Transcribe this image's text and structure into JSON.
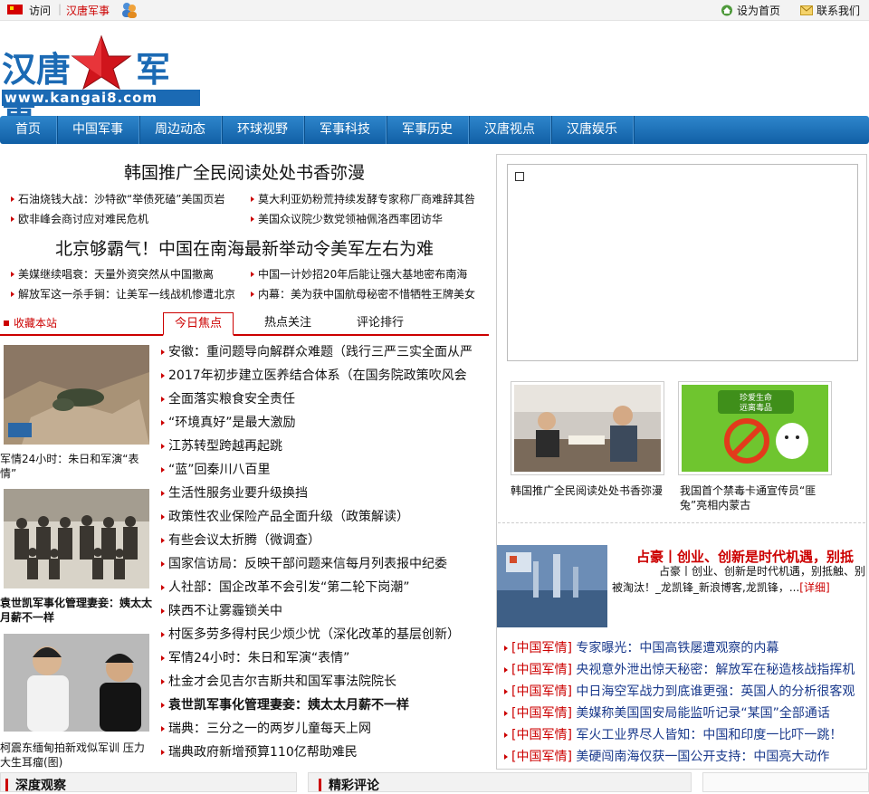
{
  "topbar": {
    "visit": "访问",
    "separator": "|",
    "site": "汉唐军事",
    "set_home": "设为首页",
    "contact": "联系我们"
  },
  "logo": {
    "name_left": "汉唐",
    "name_right": "军事",
    "url": "www.kangai8.com"
  },
  "nav": [
    "首页",
    "中国军事",
    "周边动态",
    "环球视野",
    "军事科技",
    "军事历史",
    "汉唐视点",
    "汉唐娱乐"
  ],
  "headline1": "韩国推广全民阅读处处书香弥漫",
  "news_group1": [
    [
      "石油烧钱大战：沙特欲“举债死磕”美国页岩",
      "莫大利亚奶粉荒持续发酵专家称厂商难辞其咎"
    ],
    [
      "欧非峰会商讨应对难民危机",
      "美国众议院少数党领袖佩洛西率团访华"
    ]
  ],
  "headline2": "北京够霸气！中国在南海最新举动令美军左右为难",
  "news_group2": [
    [
      "美媒继续唱衰：天量外资突然从中国撤离",
      "中国一计妙招20年后能让强大基地密布南海"
    ],
    [
      "解放军这一杀手锏：让美军一线战机惨遭北京",
      "内幕：美为获中国航母秘密不惜牺牲王牌美女"
    ]
  ],
  "tabs": {
    "favorite": "收藏本站",
    "items": [
      "今日焦点",
      "热点关注",
      "评论排行"
    ]
  },
  "left_pics": [
    {
      "caption": "军情24小时：朱日和军演“表情”"
    },
    {
      "caption": "袁世凯军事化管理妻妾：姨太太月薪不一样"
    },
    {
      "caption": "柯震东缅甸拍新戏似军训 压力大生耳瘤(图)"
    }
  ],
  "focus_list": [
    "安徽：重问题导向解群众难题（践行三严三实全面从严",
    "2017年初步建立医养结合体系（在国务院政策吹风会",
    "全面落实粮食安全责任",
    "“环境真好”是最大激励",
    "江苏转型跨越再起跳",
    "“蓝”回秦川八百里",
    "生活性服务业要升级换挡",
    "政策性农业保险产品全面升级（政策解读）",
    "有些会议太折腾（微调查）",
    "国家信访局：反映干部问题来信每月列表报中纪委",
    "人社部：国企改革不会引发“第二轮下岗潮”",
    "陕西不让雾霾锁关中",
    "村医多劳多得村民少烦少忧（深化改革的基层创新）",
    "军情24小时：朱日和军演“表情”",
    "杜金才会见吉尔吉斯共和国军事法院院长",
    "袁世凯军事化管理妻妾：姨太太月薪不一样",
    "瑞典：三分之一的两岁儿童每天上网",
    "瑞典政府新增预算110亿帮助难民"
  ],
  "right_pics": [
    {
      "caption": "韩国推广全民阅读处处书香弥漫"
    },
    {
      "caption": "我国首个禁毒卡通宣传员“匪兔”亮相内蒙古",
      "sign_text": "珍爱生命 远离毒品"
    }
  ],
  "promo": {
    "title": "占豪丨创业、创新是时代机遇，别抵",
    "text": "占豪丨创业、创新是时代机遇，别抵触、别被淘汰！_龙凯锋_新浪博客,龙凯锋，...",
    "more": "[详细]"
  },
  "right_list": [
    {
      "tag": "[中国军情]",
      "text": "专家曝光：中国高铁屡遭观察的内幕"
    },
    {
      "tag": "[中国军情]",
      "text": "央视意外泄出惊天秘密：解放军在秘造核战指挥机"
    },
    {
      "tag": "[中国军情]",
      "text": "中日海空军战力到底谁更强：英国人的分析很客观"
    },
    {
      "tag": "[中国军情]",
      "text": "美媒称美国国安局能监听记录“某国”全部通话"
    },
    {
      "tag": "[中国军情]",
      "text": "军火工业界尽人皆知：中国和印度一比吓一跳！"
    },
    {
      "tag": "[中国军情]",
      "text": "美硬闯南海仅获一国公开支持：中国亮大动作"
    }
  ],
  "bottom": {
    "deep": "深度观察",
    "comment": "精彩评论"
  },
  "colors": {
    "brand_blue": "#1b6ab4",
    "accent_red": "#cc0000",
    "nav_blue": "#1a6fb5"
  }
}
